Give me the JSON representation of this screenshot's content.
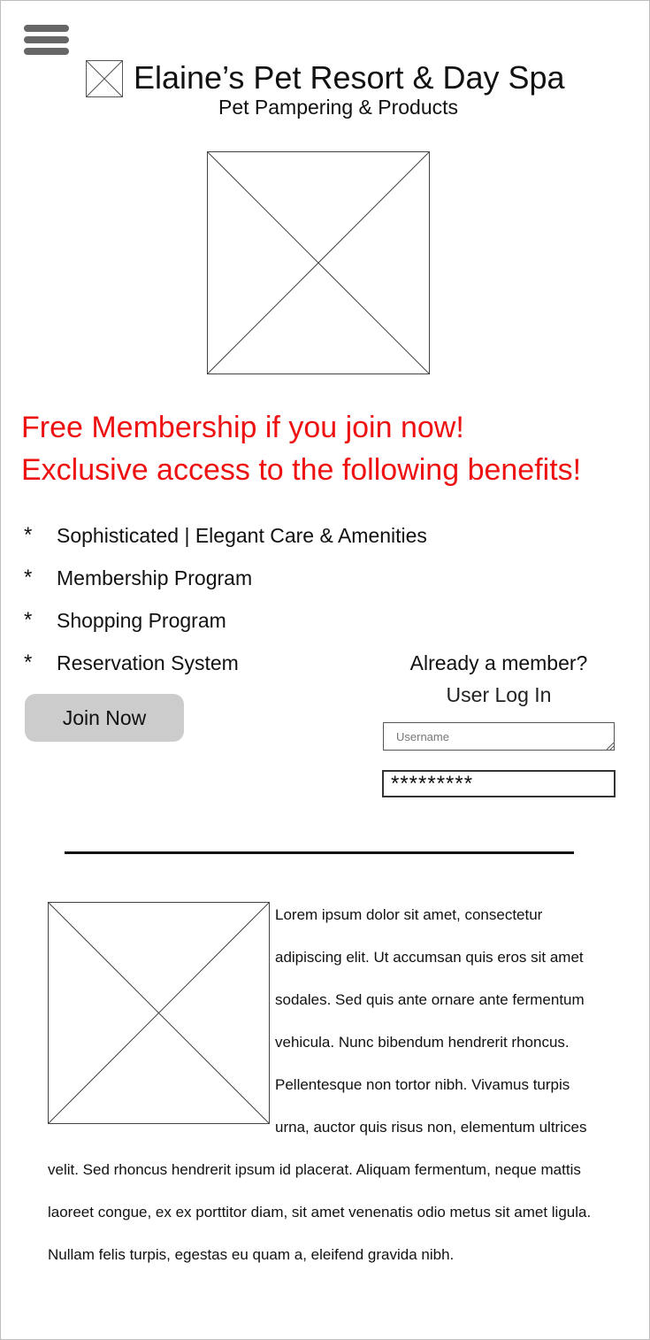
{
  "header": {
    "menu_icon": "hamburger-menu-icon",
    "logo_icon": "image-placeholder-icon",
    "title": "Elaine’s Pet Resort & Day Spa",
    "tagline": "Pet Pampering & Products"
  },
  "hero": {
    "image_icon": "image-placeholder-icon"
  },
  "promo": {
    "line1": "Free Membership if you join now!",
    "line2": "Exclusive access to the following benefits!",
    "color": "#ee1111"
  },
  "benefits": {
    "marker": "*",
    "items": [
      "Sophisticated | Elegant Care & Amenities",
      "Membership Program",
      "Shopping Program",
      "Reservation System"
    ]
  },
  "join": {
    "label": "Join Now"
  },
  "login": {
    "question": "Already a member?",
    "title": "User Log In",
    "username_placeholder": "Username",
    "password_value": "*********"
  },
  "article": {
    "image_icon": "image-placeholder-icon",
    "text": "Lorem ipsum dolor sit amet, consectetur adipiscing elit. Ut accumsan quis eros sit amet sodales. Sed quis ante ornare ante fermentum vehicula. Nunc bibendum hendrerit rhoncus. Pellentesque non tortor nibh. Vivamus turpis urna, auctor quis risus non, elementum ultrices velit. Sed rhoncus hendrerit ipsum id placerat. Aliquam fermentum, neque mattis laoreet congue, ex ex porttitor diam, sit amet venenatis odio metus sit amet ligula. Nullam felis turpis, egestas eu quam a, eleifend gravida nibh."
  }
}
